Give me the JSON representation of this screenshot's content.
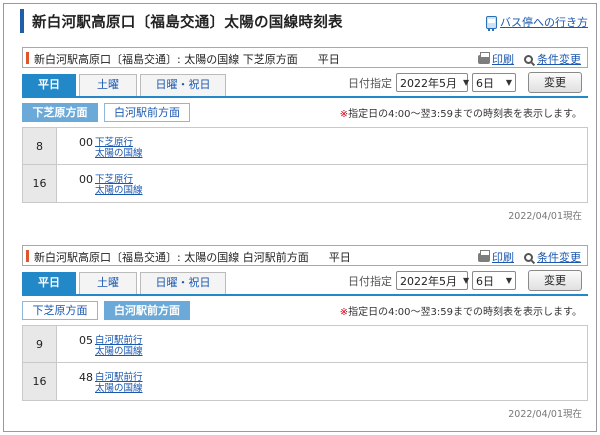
{
  "page": {
    "title": "新白河駅高原口〔福島交通〕太陽の国線時刻表",
    "bus_stop_link": "バス停への行き方"
  },
  "common": {
    "print": "印刷",
    "conditions": "条件変更",
    "date_label": "日付指定",
    "month_value": "2022年5月",
    "day_value": "6日",
    "change_button": "変更",
    "notice": "指定日の4:00～翌3:59までの時刻表を表示します。",
    "notice_mark": "※",
    "day_tabs": [
      "平日",
      "土曜",
      "日曜・祝日"
    ]
  },
  "sections": [
    {
      "title": "新白河駅高原口〔福島交通〕: 太陽の国線 下芝原方面",
      "day_type": "平日",
      "directions": [
        "下芝原方面",
        "白河駅前方面"
      ],
      "active_direction": 0,
      "rows": [
        {
          "hour": "8",
          "minute": "00",
          "dest": "下芝原行",
          "route": "太陽の国線"
        },
        {
          "hour": "16",
          "minute": "00",
          "dest": "下芝原行",
          "route": "太陽の国線"
        }
      ],
      "as_of": "2022/04/01現在"
    },
    {
      "title": "新白河駅高原口〔福島交通〕: 太陽の国線 白河駅前方面",
      "day_type": "平日",
      "directions": [
        "下芝原方面",
        "白河駅前方面"
      ],
      "active_direction": 1,
      "rows": [
        {
          "hour": "9",
          "minute": "05",
          "dest": "白河駅前行",
          "route": "太陽の国線"
        },
        {
          "hour": "16",
          "minute": "48",
          "dest": "白河駅前行",
          "route": "太陽の国線"
        }
      ],
      "as_of": "2022/04/01現在"
    }
  ],
  "colors": {
    "title_accent": "#1f5fa8",
    "section_accent": "#e2552a",
    "tab_active": "#2288c8",
    "direction_active": "#6aa9d8",
    "link": "#1a57b0",
    "notice_mark": "#d0021b"
  }
}
